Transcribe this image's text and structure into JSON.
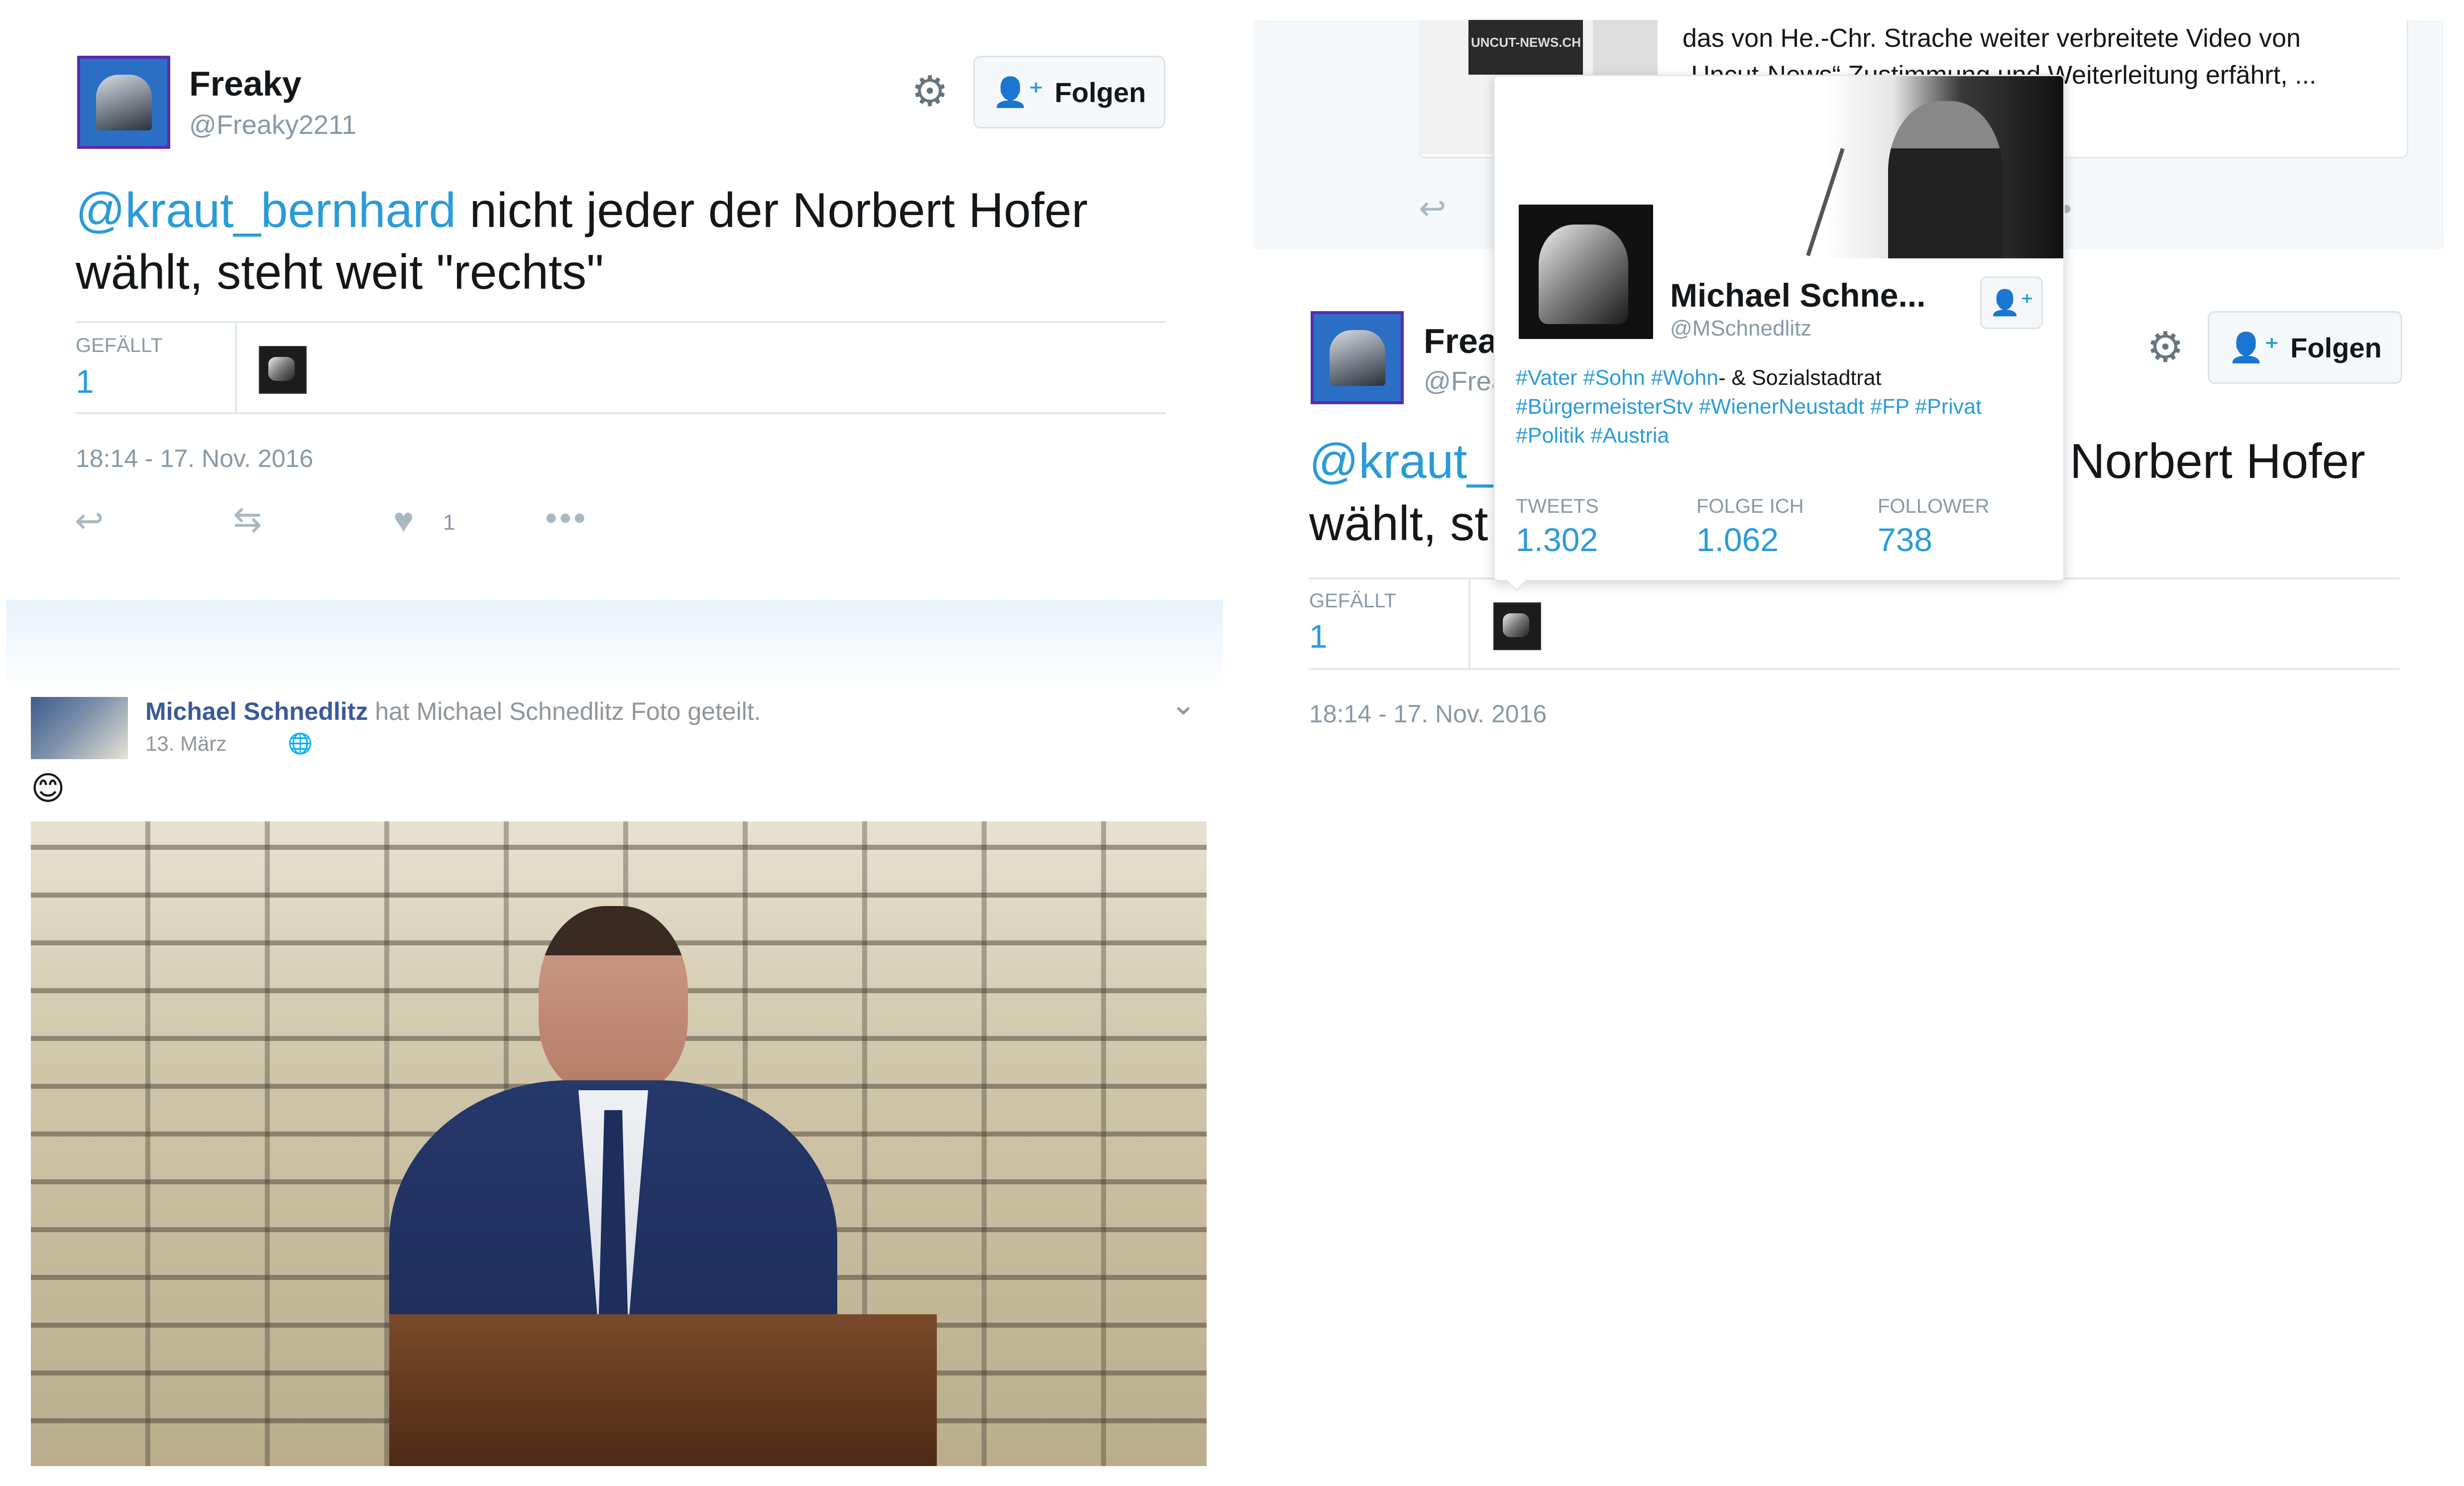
{
  "left_tweet": {
    "display_name": "Freaky",
    "handle": "@Freaky2211",
    "follow_label": "Folgen",
    "mention": "@kraut_bernhard",
    "text_rest_line1": " nicht jeder der Norbert Hofer",
    "text_line2": "wählt, steht weit \"rechts\"",
    "likes_label": "GEFÄLLT",
    "likes_count": "1",
    "timestamp": "18:14 - 17. Nov. 2016",
    "heart_count": "1"
  },
  "facebook_post": {
    "author": "Michael Schnedlitz",
    "shared_text": "hat Michael Schnedlitz Foto geteilt.",
    "date": "13. März",
    "emoji": "😊"
  },
  "right_panel": {
    "top_snippet_line1": "das von He.-Chr. Strache weiter verbreitete Video von",
    "top_snippet_line2": "„Uncut-News“ Zustimmung und Weiterleitung erfährt, ...",
    "thumb_label": "UNCUT-NEWS.CH",
    "display_name_partial": "Frea",
    "handle_partial": "@Frea",
    "follow_label": "Folgen",
    "mention_partial": "@kraut_",
    "text_right_line1": "Norbert Hofer",
    "text_line2_partial": "wählt, st",
    "likes_label": "GEFÄLLT",
    "likes_count": "1",
    "timestamp": "18:14 - 17. Nov. 2016"
  },
  "hover_card": {
    "name": "Michael Schne...",
    "handle": "@MSchnedlitz",
    "bio_line1_tags": "#Vater #Sohn #Wohn",
    "bio_line1_rest": "- & Sozialstadtrat",
    "bio_line2": "#BürgermeisterStv #WienerNeustadt #FP #Privat",
    "bio_line3": "#Politik #Austria",
    "stats": [
      {
        "label": "TWEETS",
        "value": "1.302"
      },
      {
        "label": "FOLGE ICH",
        "value": "1.062"
      },
      {
        "label": "FOLLOWER",
        "value": "738"
      }
    ]
  },
  "colors": {
    "link_blue": "#2b9bd8",
    "muted_gray": "#8899a6",
    "facebook_blue": "#3b5998",
    "border": "#e1e8ed"
  }
}
